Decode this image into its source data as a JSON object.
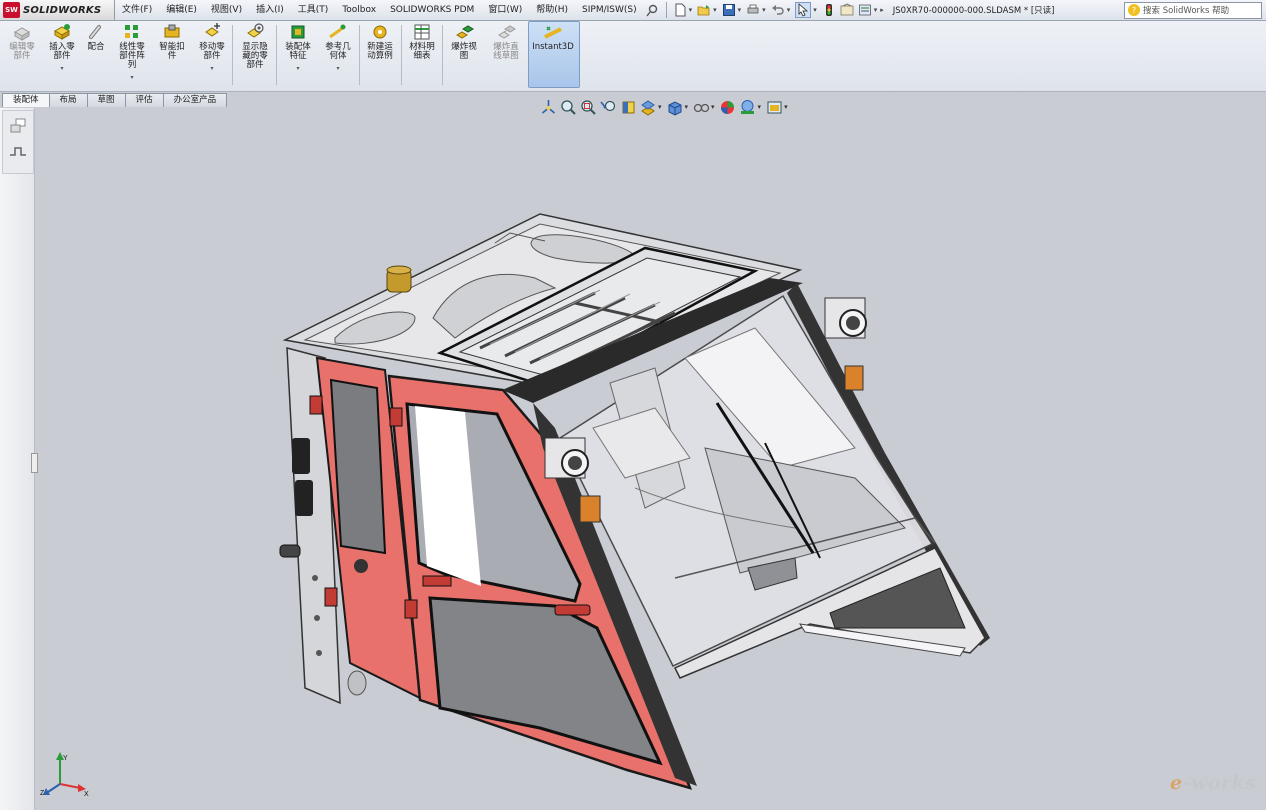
{
  "app": {
    "name": "SOLIDWORKS",
    "logo_text": "SW"
  },
  "menu": {
    "items": [
      "文件(F)",
      "编辑(E)",
      "视图(V)",
      "插入(I)",
      "工具(T)",
      "Toolbox",
      "SOLIDWORKS PDM",
      "窗口(W)",
      "帮助(H)",
      "SIPM/ISW(S)"
    ]
  },
  "document": {
    "title": "JS0XR70-000000-000.SLDASM * [只读]"
  },
  "help_search": {
    "placeholder": "搜索 SolidWorks 帮助"
  },
  "commands": [
    {
      "label": "编辑零\n部件",
      "icon": "edit-component-icon",
      "enabled": false,
      "dropdown": false
    },
    {
      "label": "插入零\n部件",
      "icon": "insert-component-icon",
      "enabled": true,
      "dropdown": true
    },
    {
      "label": "配合",
      "icon": "mate-icon",
      "enabled": true,
      "dropdown": false
    },
    {
      "label": "线性零\n部件阵\n列",
      "icon": "linear-pattern-icon",
      "enabled": true,
      "dropdown": true
    },
    {
      "label": "智能扣\n件",
      "icon": "smart-fasteners-icon",
      "enabled": true,
      "dropdown": false
    },
    {
      "label": "移动零\n部件",
      "icon": "move-component-icon",
      "enabled": true,
      "dropdown": true
    },
    {
      "label": "显示隐\n藏的零\n部件",
      "icon": "show-hidden-icon",
      "enabled": true,
      "dropdown": false
    },
    {
      "label": "装配体\n特征",
      "icon": "assembly-features-icon",
      "enabled": true,
      "dropdown": true
    },
    {
      "label": "参考几\n何体",
      "icon": "reference-geometry-icon",
      "enabled": true,
      "dropdown": true
    },
    {
      "label": "新建运\n动算例",
      "icon": "motion-study-icon",
      "enabled": true,
      "dropdown": false
    },
    {
      "label": "材料明\n细表",
      "icon": "bom-icon",
      "enabled": true,
      "dropdown": false
    },
    {
      "label": "爆炸视\n图",
      "icon": "exploded-view-icon",
      "enabled": true,
      "dropdown": false
    },
    {
      "label": "爆炸直\n线草图",
      "icon": "explode-line-icon",
      "enabled": false,
      "dropdown": false
    },
    {
      "label": "Instant3D",
      "icon": "instant3d-icon",
      "enabled": true,
      "dropdown": false,
      "active": true
    }
  ],
  "tabs": [
    {
      "label": "装配体",
      "active": true
    },
    {
      "label": "布局",
      "active": false
    },
    {
      "label": "草图",
      "active": false
    },
    {
      "label": "评估",
      "active": false
    },
    {
      "label": "办公室产品",
      "active": false
    }
  ],
  "view_toolbar": [
    "view-orientation-icon",
    "zoom-to-fit-icon",
    "zoom-to-area-icon",
    "previous-view-icon",
    "section-view-icon",
    "dynamic-annotation-icon",
    "display-style-icon",
    "hide-show-icon",
    "edit-appearance-icon",
    "apply-scene-icon",
    "view-setting-icon"
  ],
  "triad": {
    "x_label": "X",
    "y_label": "Y",
    "z_label": "Z"
  },
  "watermark": {
    "prefix": "e",
    "text": "-works"
  },
  "colors": {
    "viewport_bg": "#c9ccd3",
    "door_red": "#e8716c",
    "door_outline": "#1a1a1a",
    "frame_grey": "#dcdde0",
    "instant3d_active": "#b4cdef"
  }
}
